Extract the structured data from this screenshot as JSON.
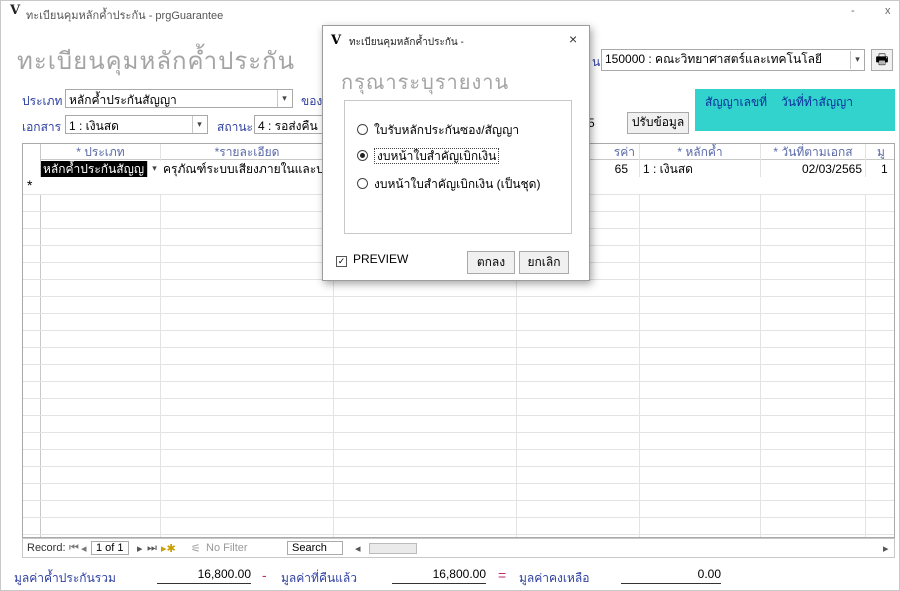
{
  "window": {
    "app_icon": "V",
    "title": "ทะเบียนคุมหลักค้ำประกัน - prgGuarantee",
    "minimize": "-",
    "close": "x"
  },
  "form": {
    "title": "ทะเบียนคุมหลักค้ำประกัน",
    "unit_label_fragment": "น",
    "unit_value": "150000 : คณะวิทยาศาสตร์และเทคโนโลยี",
    "type_label": "ประเภท",
    "type_value": "หลักค้ำประกันสัญญา",
    "of_label_fragment": "ของ",
    "doc_label": "เอกสาร",
    "doc_value": "1 : เงินสด",
    "status_label": "สถานะ",
    "status_value": "4 : รอส่งคืน",
    "contract_no_label": "สัญญาเลขที่",
    "contract_date_label": "วันที่ทำสัญญา",
    "hidden_value_fragment": "5",
    "adjust_button": "ปรับข้อมูล",
    "print_icon": "printer-icon"
  },
  "grid": {
    "headers": [
      "* ประเภท",
      "*รายละเอียด",
      "",
      "รค่า",
      "* หลักค้ำ",
      "* วันที่ตามเอกส",
      "มู"
    ],
    "rows": [
      [
        "หลักค้ำประกันสัญญ",
        "ครุภัณฑ์ระบบเสียงภายในและบ",
        "",
        "65",
        "1 : เงินสด",
        "02/03/2565",
        "1"
      ]
    ],
    "new_row_marker": "*"
  },
  "navbar": {
    "record_label": "Record:",
    "position": "1 of 1",
    "filter": "No Filter",
    "search": "Search"
  },
  "totals": {
    "total_label": "มูลค่าค้ำประกันรวม",
    "total_value": "16,800.00",
    "minus": "-",
    "returned_label": "มูลค่าที่คืนแล้ว",
    "returned_value": "16,800.00",
    "equals": "=",
    "remaining_label": "มูลค่าคงเหลือ",
    "remaining_value": "0.00"
  },
  "dialog": {
    "icon": "V",
    "title": "ทะเบียนคุมหลักค้ำประกัน -",
    "close": "×",
    "heading": "กรุณาระบุรายงาน",
    "options": [
      "ใบรับหลักประกันซอง/สัญญา",
      "งบหน้าใบสำคัญเบิกเงิน",
      "งบหน้าใบสำคัญเบิกเงิน (เป็นชุด)"
    ],
    "selected_index": 1,
    "preview_label": "PREVIEW",
    "preview_checked": true,
    "ok_button": "ตกลง",
    "cancel_button": "ยกเลิก"
  }
}
